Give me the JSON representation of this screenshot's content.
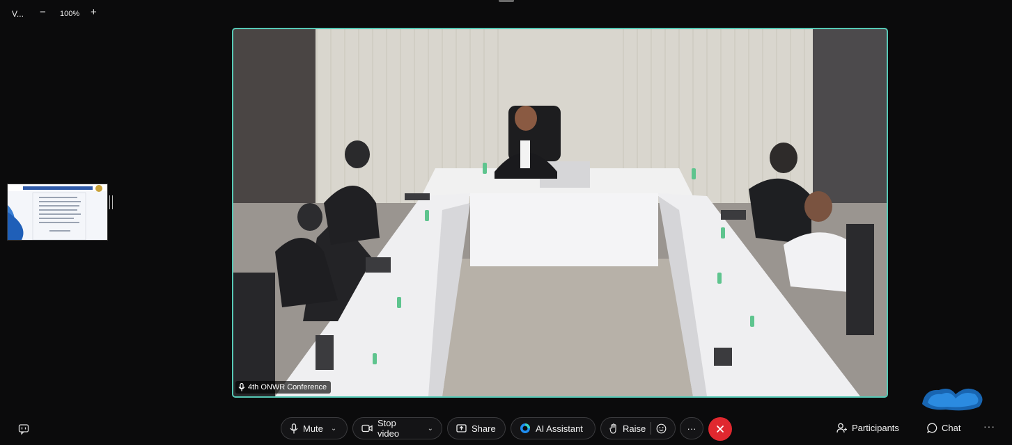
{
  "topbar": {
    "title": "V...",
    "zoom_minus": "−",
    "zoom_level": "100%",
    "zoom_plus": "+"
  },
  "video": {
    "participant_name": "4th ONWR Conference",
    "border_color": "#56c9b6"
  },
  "controls": {
    "mute_label": "Mute",
    "stop_video_label": "Stop video",
    "share_label": "Share",
    "ai_assistant_label": "AI Assistant",
    "raise_label": "Raise",
    "more_label": "···",
    "participants_label": "Participants",
    "chat_label": "Chat",
    "more_right_label": "···",
    "end_color": "#e0282f"
  },
  "icons": [
    "mic-icon",
    "camera-icon",
    "share-icon",
    "ai-assistant-icon",
    "hand-icon",
    "reaction-icon",
    "close-icon",
    "participants-icon",
    "chat-icon",
    "captions-icon"
  ]
}
